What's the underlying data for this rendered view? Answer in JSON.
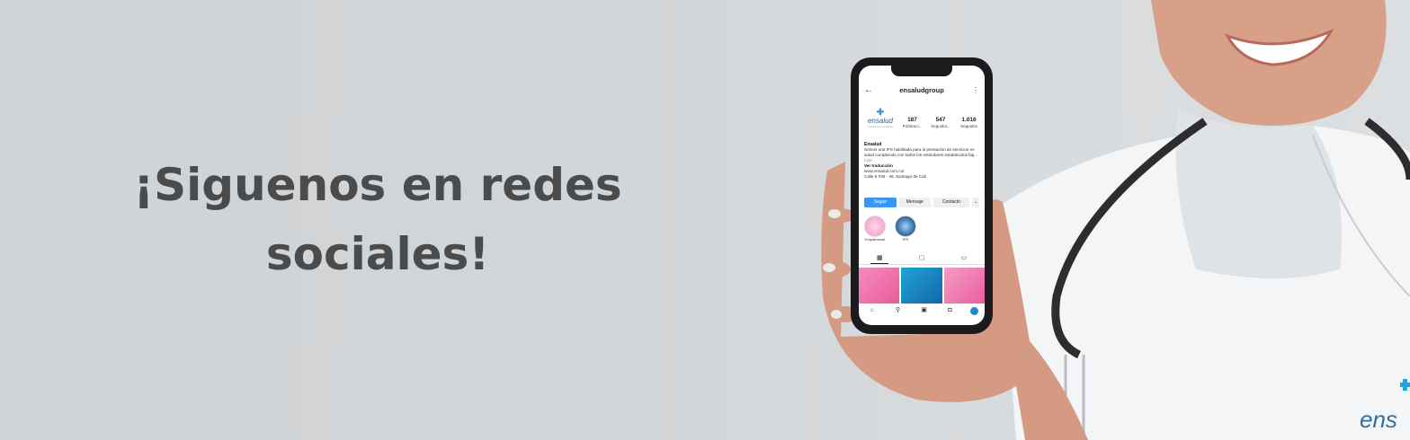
{
  "headline": {
    "line1": "¡Siguenos en redes",
    "line2": "sociales!"
  },
  "phone": {
    "username": "ensaludgroup",
    "icons": {
      "back": "arrow-left-icon",
      "menu": "more-vertical-icon"
    },
    "profile_logo": {
      "word": "ensalud",
      "tagline": "Soluciones en Salud"
    },
    "stats": [
      {
        "value": "187",
        "label": "Publicaci..."
      },
      {
        "value": "547",
        "label": "Seguidor..."
      },
      {
        "value": "1.016",
        "label": "Seguidos"
      }
    ],
    "bio": {
      "name": "Ensalud",
      "text": "Somos una IPS habilitada para la prestación de servicios en salud cumpliendo con todos los estándares establecidos baj...",
      "more": "más",
      "translate": "Ver traducción",
      "website": "www.ensalud.com.co/",
      "address": "Calle 5 #39 - 46, Santiago de Cali"
    },
    "buttons": {
      "follow": "Seguir",
      "message": "Mensaje",
      "contact": "Contacto",
      "chevron": "⌄"
    },
    "highlights": [
      {
        "label": "Empalmesal",
        "color": "#f7a8cf"
      },
      {
        "label": "IPS",
        "color": "#245a8a"
      }
    ],
    "bottom_nav": [
      "home-icon",
      "search-icon",
      "reels-icon",
      "shop-icon",
      "profile-avatar"
    ]
  },
  "colors": {
    "background": "#d3d6d8",
    "headline": "#4a4b4d",
    "brand_blue": "#2a9fd8",
    "follow_button": "#3897f0"
  },
  "brand_corner": "ens"
}
